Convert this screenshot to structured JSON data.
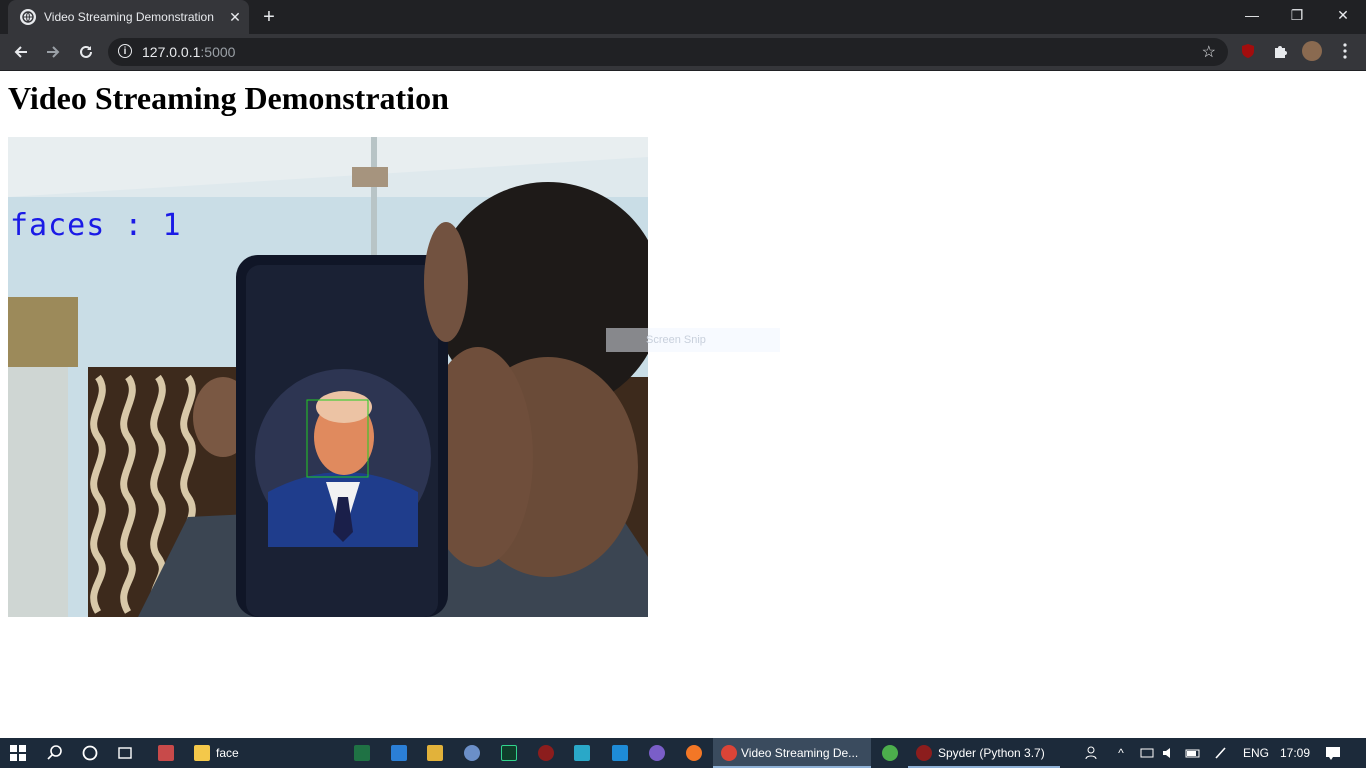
{
  "browser": {
    "tab_title": "Video Streaming Demonstration",
    "new_tab_label": "+",
    "url_host": "127.0.0.1",
    "url_port": ":5000",
    "window_controls": {
      "minimize": "—",
      "restore": "❐",
      "close": "✕"
    }
  },
  "page": {
    "heading": "Video Streaming Demonstration",
    "video_overlay": "faces : 1",
    "snip_hint": "Screen Snip"
  },
  "taskbar": {
    "search_icon": "search-icon",
    "folder_label": "face",
    "chrome_window": "Video Streaming De...",
    "spyder_window": "Spyder (Python 3.7)",
    "language": "ENG",
    "clock": "17:09"
  },
  "colors": {
    "chrome_dark": "#202124",
    "chrome_tab": "#35363a",
    "taskbar": "#1c2a3a",
    "overlay_text": "#1a1ae6",
    "detection_box": "#22cc22"
  }
}
